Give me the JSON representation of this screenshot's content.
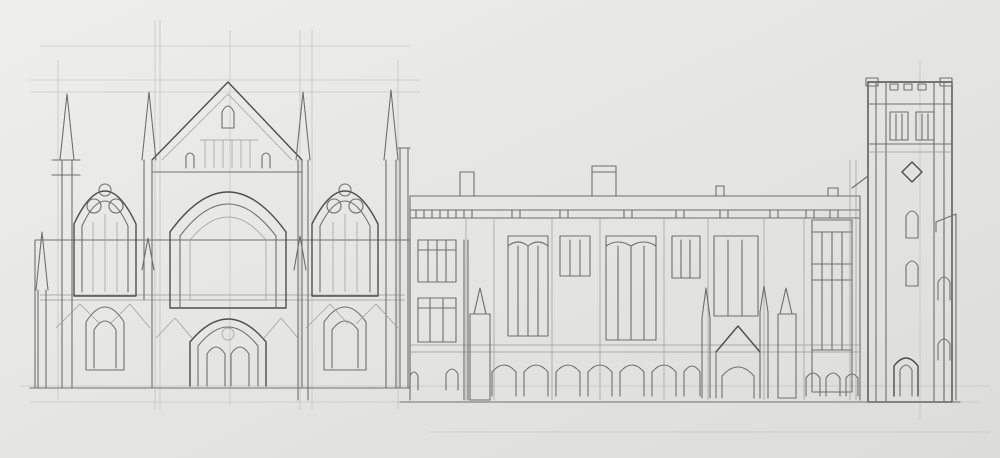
{
  "image": {
    "subject": "pencil-elevation-drawing",
    "colors": {
      "paper": "#e6e6e4",
      "graphite": "#6f6f6d",
      "graphite_dark": "#4e4e4c",
      "guide": "#b9b9b6"
    }
  }
}
